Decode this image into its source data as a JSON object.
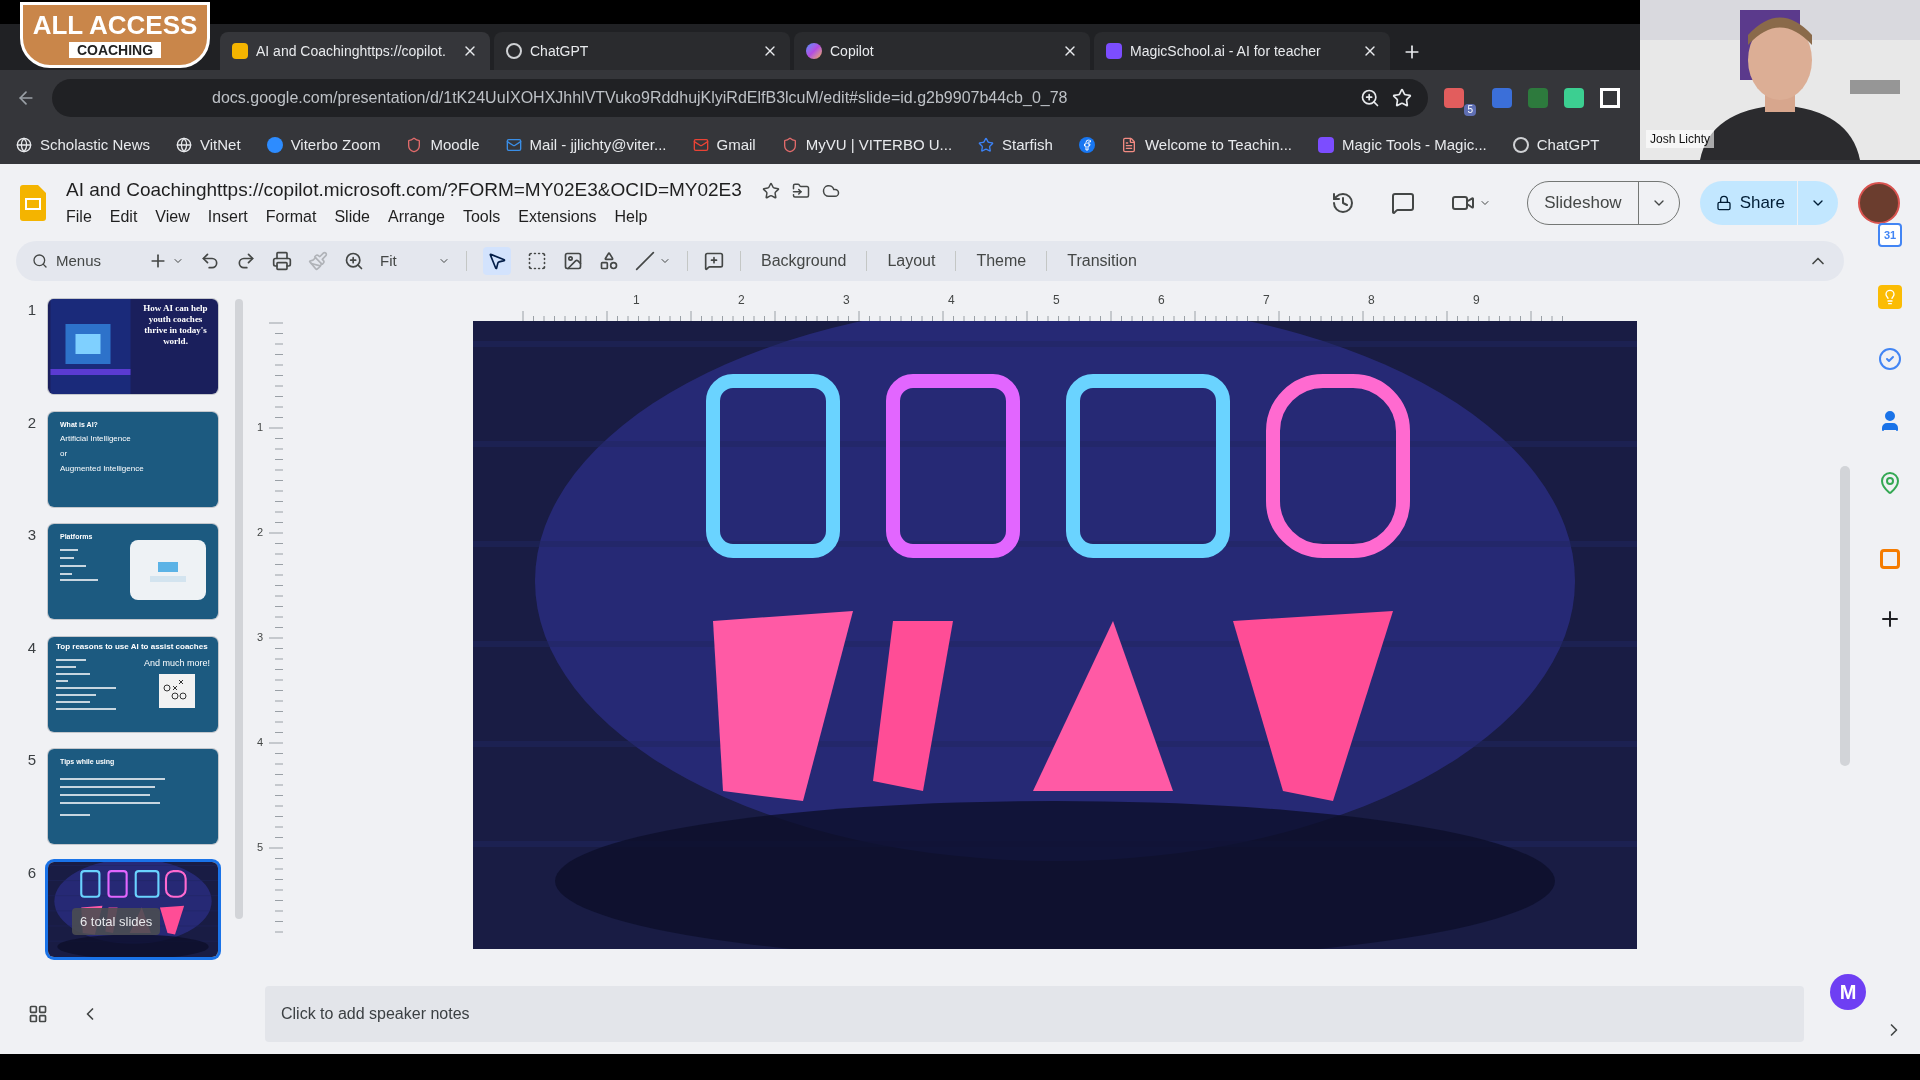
{
  "overlay_logo": {
    "line1": "ALL ACCESS",
    "line2": "COACHING"
  },
  "tabs": [
    {
      "title": "AI and Coachinghttps://copilot.",
      "selected": true
    },
    {
      "title": "ChatGPT",
      "selected": false
    },
    {
      "title": "Copilot",
      "selected": false
    },
    {
      "title": "MagicSchool.ai - AI for teacher",
      "selected": false
    }
  ],
  "address": "docs.google.com/presentation/d/1tK24UuIXOHXJhhlVTVuko9RddhujKlyiRdElfB3lcuM/edit#slide=id.g2b9907b44cb_0_78",
  "extension_badge": "5",
  "bookmarks": [
    {
      "kind": "link",
      "label": "Scholastic News"
    },
    {
      "kind": "link",
      "label": "VitNet"
    },
    {
      "kind": "link",
      "label": "Viterbo Zoom"
    },
    {
      "kind": "link",
      "label": "Moodle"
    },
    {
      "kind": "link",
      "label": "Mail - jjlichty@viter..."
    },
    {
      "kind": "link",
      "label": "Gmail"
    },
    {
      "kind": "link",
      "label": "MyVU | VITERBO U..."
    },
    {
      "kind": "link",
      "label": "Starfish"
    },
    {
      "kind": "icon"
    },
    {
      "kind": "link",
      "label": "Welcome to Teachin..."
    },
    {
      "kind": "link",
      "label": "Magic Tools - Magic..."
    },
    {
      "kind": "link",
      "label": "ChatGPT"
    }
  ],
  "webcam": {
    "name": "Josh Lichty"
  },
  "doc": {
    "title": "AI and Coachinghttps://copilot.microsoft.com/?FORM=MY02E3&OCID=MY02E3",
    "menu": [
      "File",
      "Edit",
      "View",
      "Insert",
      "Format",
      "Slide",
      "Arrange",
      "Tools",
      "Extensions",
      "Help"
    ],
    "slideshow": "Slideshow",
    "share": "Share"
  },
  "toolbar": {
    "search": "Menus",
    "zoom": "Fit",
    "buttons": [
      "Background",
      "Layout",
      "Theme",
      "Transition"
    ]
  },
  "ruler": {
    "h": [
      "1",
      "2",
      "3",
      "4",
      "5",
      "6",
      "7",
      "8",
      "9"
    ],
    "v": [
      "1",
      "2",
      "3",
      "4",
      "5"
    ]
  },
  "slides": [
    {
      "number": "1",
      "kind": "title",
      "selected": false,
      "texts": [
        "How AI can help youth coaches thrive in today's world."
      ]
    },
    {
      "number": "2",
      "kind": "text",
      "selected": false,
      "texts": [
        "What is AI?",
        "Artificial Intelligence",
        "or",
        "Augmented Intelligence"
      ]
    },
    {
      "number": "3",
      "kind": "list_image",
      "selected": false,
      "texts": [
        "Platforms"
      ]
    },
    {
      "number": "4",
      "kind": "list_play",
      "selected": false,
      "texts": [
        "Top reasons to use AI to assist coaches",
        "And much more!"
      ]
    },
    {
      "number": "5",
      "kind": "list",
      "selected": false,
      "texts": [
        "Tips while using"
      ]
    },
    {
      "number": "6",
      "kind": "neon",
      "selected": true
    }
  ],
  "slide_tooltip": "6 total slides",
  "calendar_day": "31",
  "notes": {
    "placeholder": "Click to add speaker notes"
  },
  "assistant_letter": "M"
}
